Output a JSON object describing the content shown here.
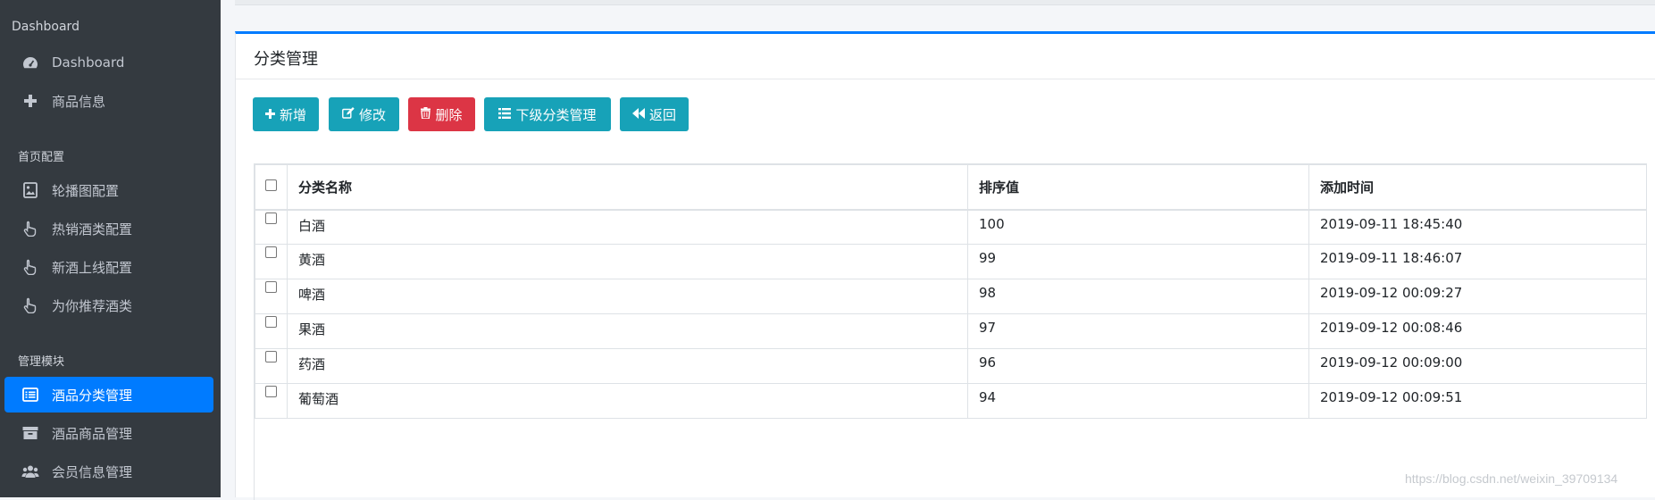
{
  "sidebar": {
    "sections": [
      {
        "header": "Dashboard"
      },
      {
        "header": "首页配置"
      },
      {
        "header": "管理模块"
      }
    ],
    "items": [
      {
        "label": "Dashboard",
        "icon": "tachometer-icon"
      },
      {
        "label": "商品信息",
        "icon": "plus-icon"
      },
      {
        "label": "轮播图配置",
        "icon": "image-icon"
      },
      {
        "label": "热销酒类配置",
        "icon": "hand-pointer-icon"
      },
      {
        "label": "新酒上线配置",
        "icon": "hand-pointer-icon"
      },
      {
        "label": "为你推荐酒类",
        "icon": "hand-pointer-icon"
      },
      {
        "label": "酒品分类管理",
        "icon": "list-icon",
        "active": true
      },
      {
        "label": "酒品商品管理",
        "icon": "archive-icon"
      },
      {
        "label": "会员信息管理",
        "icon": "users-icon"
      }
    ]
  },
  "card": {
    "title": "分类管理"
  },
  "toolbar": {
    "add_label": "新增",
    "edit_label": "修改",
    "delete_label": "删除",
    "sub_label": "下级分类管理",
    "back_label": "返回"
  },
  "table": {
    "headers": [
      "分类名称",
      "排序值",
      "添加时间"
    ],
    "rows": [
      {
        "name": "白酒",
        "sort": "100",
        "time": "2019-09-11 18:45:40"
      },
      {
        "name": "黄酒",
        "sort": "99",
        "time": "2019-09-11 18:46:07"
      },
      {
        "name": "啤酒",
        "sort": "98",
        "time": "2019-09-12 00:09:27"
      },
      {
        "name": "果酒",
        "sort": "97",
        "time": "2019-09-12 00:08:46"
      },
      {
        "name": "药酒",
        "sort": "96",
        "time": "2019-09-12 00:09:00"
      },
      {
        "name": "葡萄酒",
        "sort": "94",
        "time": "2019-09-12 00:09:51"
      }
    ]
  },
  "watermark": "https://blog.csdn.net/weixin_39709134",
  "colors": {
    "sidebar_bg": "#343a40",
    "primary": "#007bff",
    "info": "#17a2b8",
    "danger": "#dc3545"
  }
}
